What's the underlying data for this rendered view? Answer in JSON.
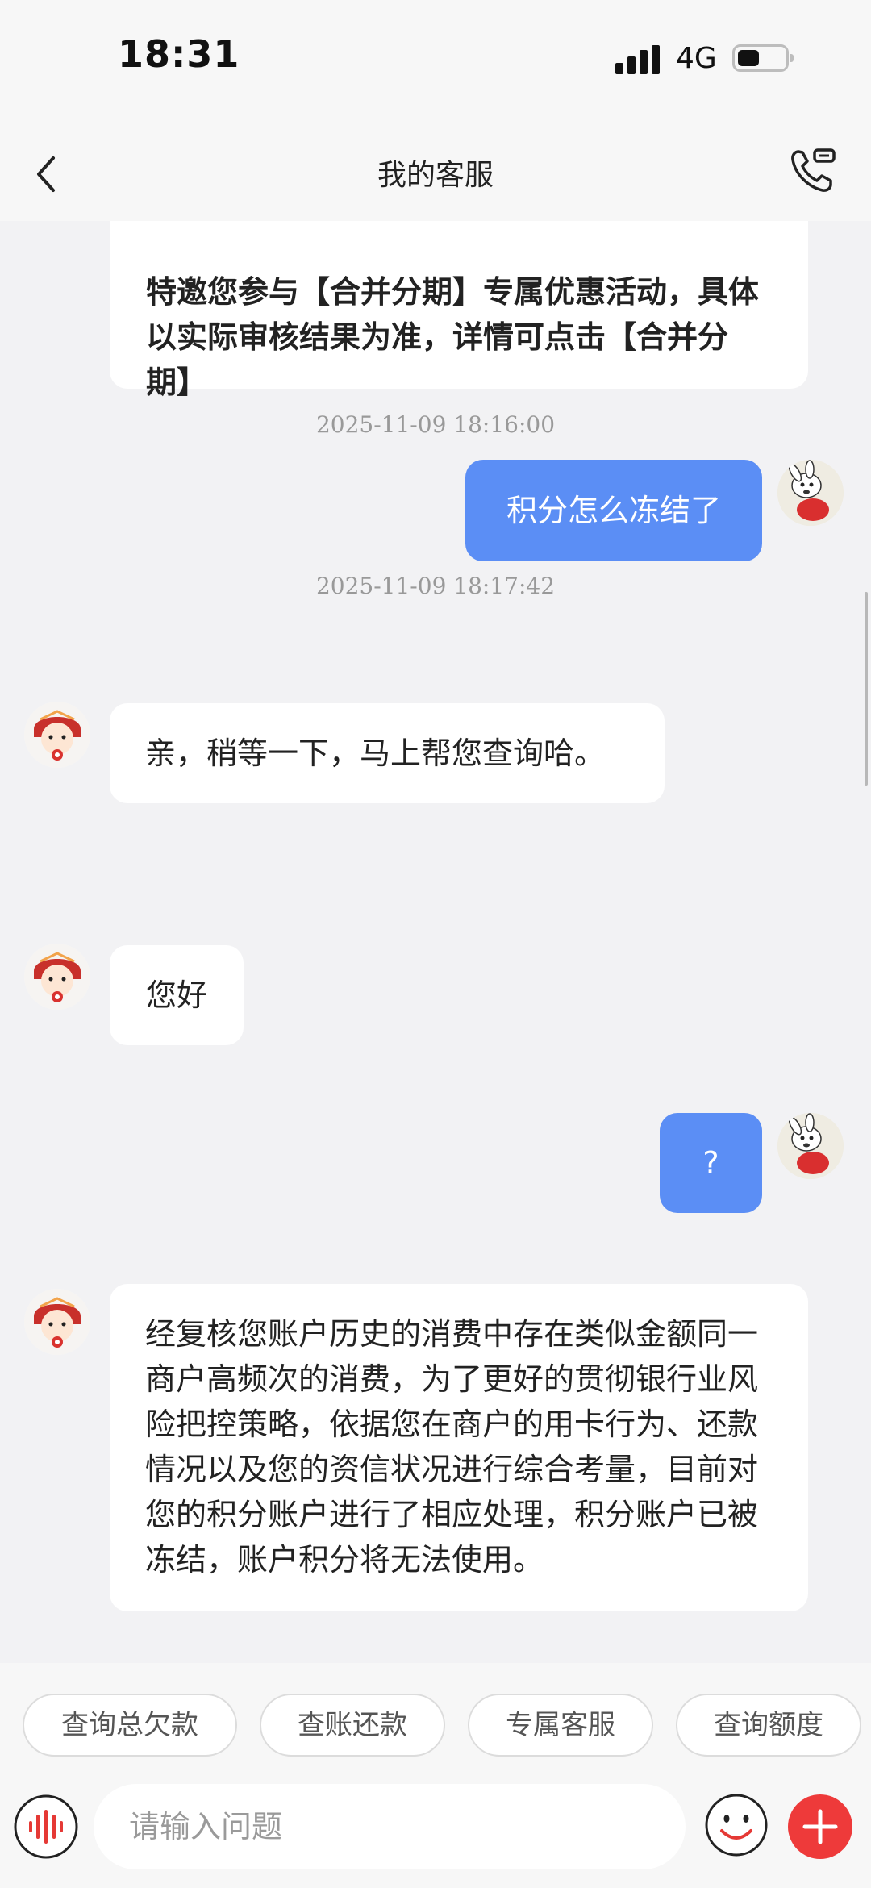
{
  "status_bar": {
    "time": "18:31",
    "network": "4G"
  },
  "header": {
    "title": "我的客服"
  },
  "messages": {
    "promo_text": "特邀您参与【合并分期】专属优惠活动，具体以实际审核结果为准，详情可点击【合并分期】",
    "user_1": "积分怎么冻结了",
    "time_1": "2025-11-09 18:16:00",
    "agent_1": "亲，稍等一下，马上帮您查询哈。",
    "time_2": "2025-11-09 18:17:42",
    "agent_2": "您好",
    "user_2": "?",
    "agent_3": "经复核您账户历史的消费中存在类似金额同一商户高频次的消费，为了更好的贯彻银行业风险把控策略，依据您在商户的用卡行为、还款情况以及您的资信状况进行综合考量，目前对您的积分账户进行了相应处理，积分账户已被冻结，账户积分将无法使用。"
  },
  "quick_replies": [
    "查询总欠款",
    "查账还款",
    "专属客服",
    "查询额度"
  ],
  "input": {
    "placeholder": "请输入问题"
  },
  "colors": {
    "user_bubble": "#5b8ef5",
    "promo_text": "#4c80ea",
    "plus_button": "#ee3a3a",
    "background": "#f2f2f4"
  },
  "icons": [
    "back-arrow-icon",
    "phone-service-icon",
    "voice-icon",
    "emoji-icon",
    "plus-icon"
  ]
}
